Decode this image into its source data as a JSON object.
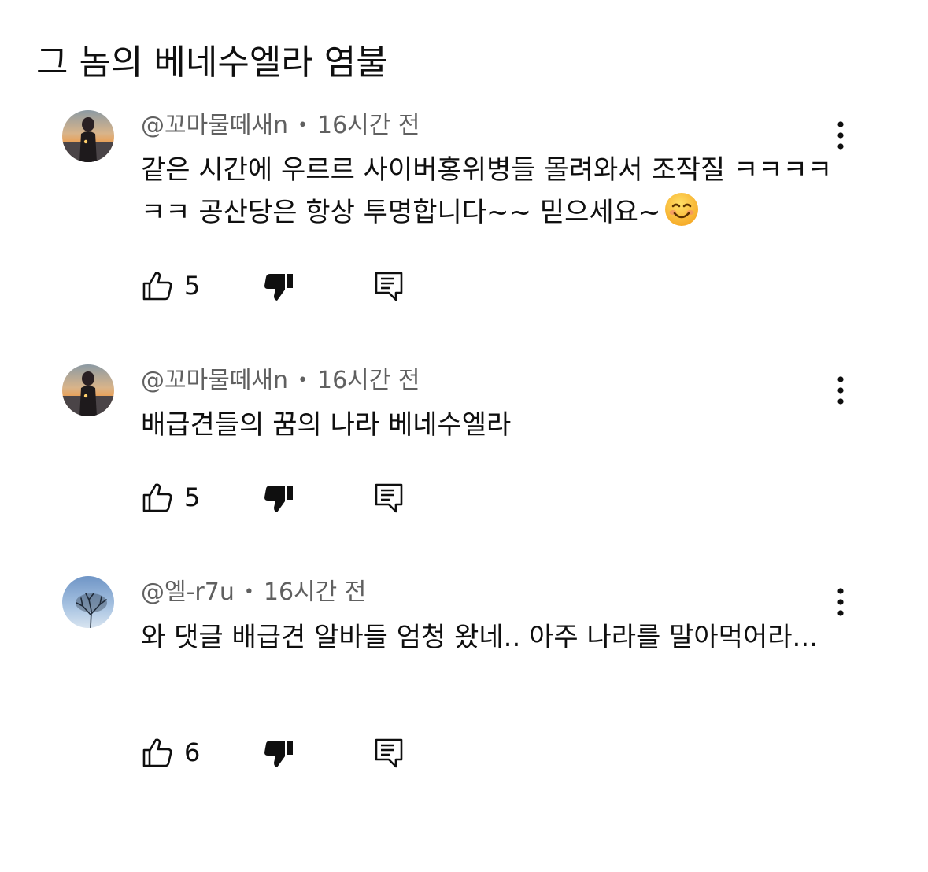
{
  "parent_comment": {
    "text": "그 놈의 베네수엘라 염불"
  },
  "comments": [
    {
      "author": "@꼬마물떼새n",
      "separator": "•",
      "time": "16시간 전",
      "text": "같은 시간에 우르르 사이버홍위병들 몰려와서 조작질 ㅋㅋㅋㅋㅋㅋ 공산당은 항상 투명합니다~~ 믿으세요~",
      "emoji": "smiling-face",
      "likes": "5",
      "avatar": "sunset-woman-avatar"
    },
    {
      "author": "@꼬마물떼새n",
      "separator": "•",
      "time": "16시간 전",
      "text": "배급견들의 꿈의 나라 베네수엘라",
      "likes": "5",
      "avatar": "sunset-woman-avatar"
    },
    {
      "author": "@엘-r7u",
      "separator": "•",
      "time": "16시간 전",
      "text": "와 댓글 배급견 알바들 엄청 왔네.. 아주 나라를 말아먹어라...",
      "likes": "6",
      "avatar": "tree-sky-avatar"
    }
  ],
  "icons": {
    "like": "thumbs-up-icon",
    "dislike": "thumbs-down-icon",
    "reply": "reply-icon",
    "menu": "more-vert-icon"
  },
  "colors": {
    "text": "#0f0f0f",
    "secondary": "#606060",
    "background": "#ffffff"
  }
}
